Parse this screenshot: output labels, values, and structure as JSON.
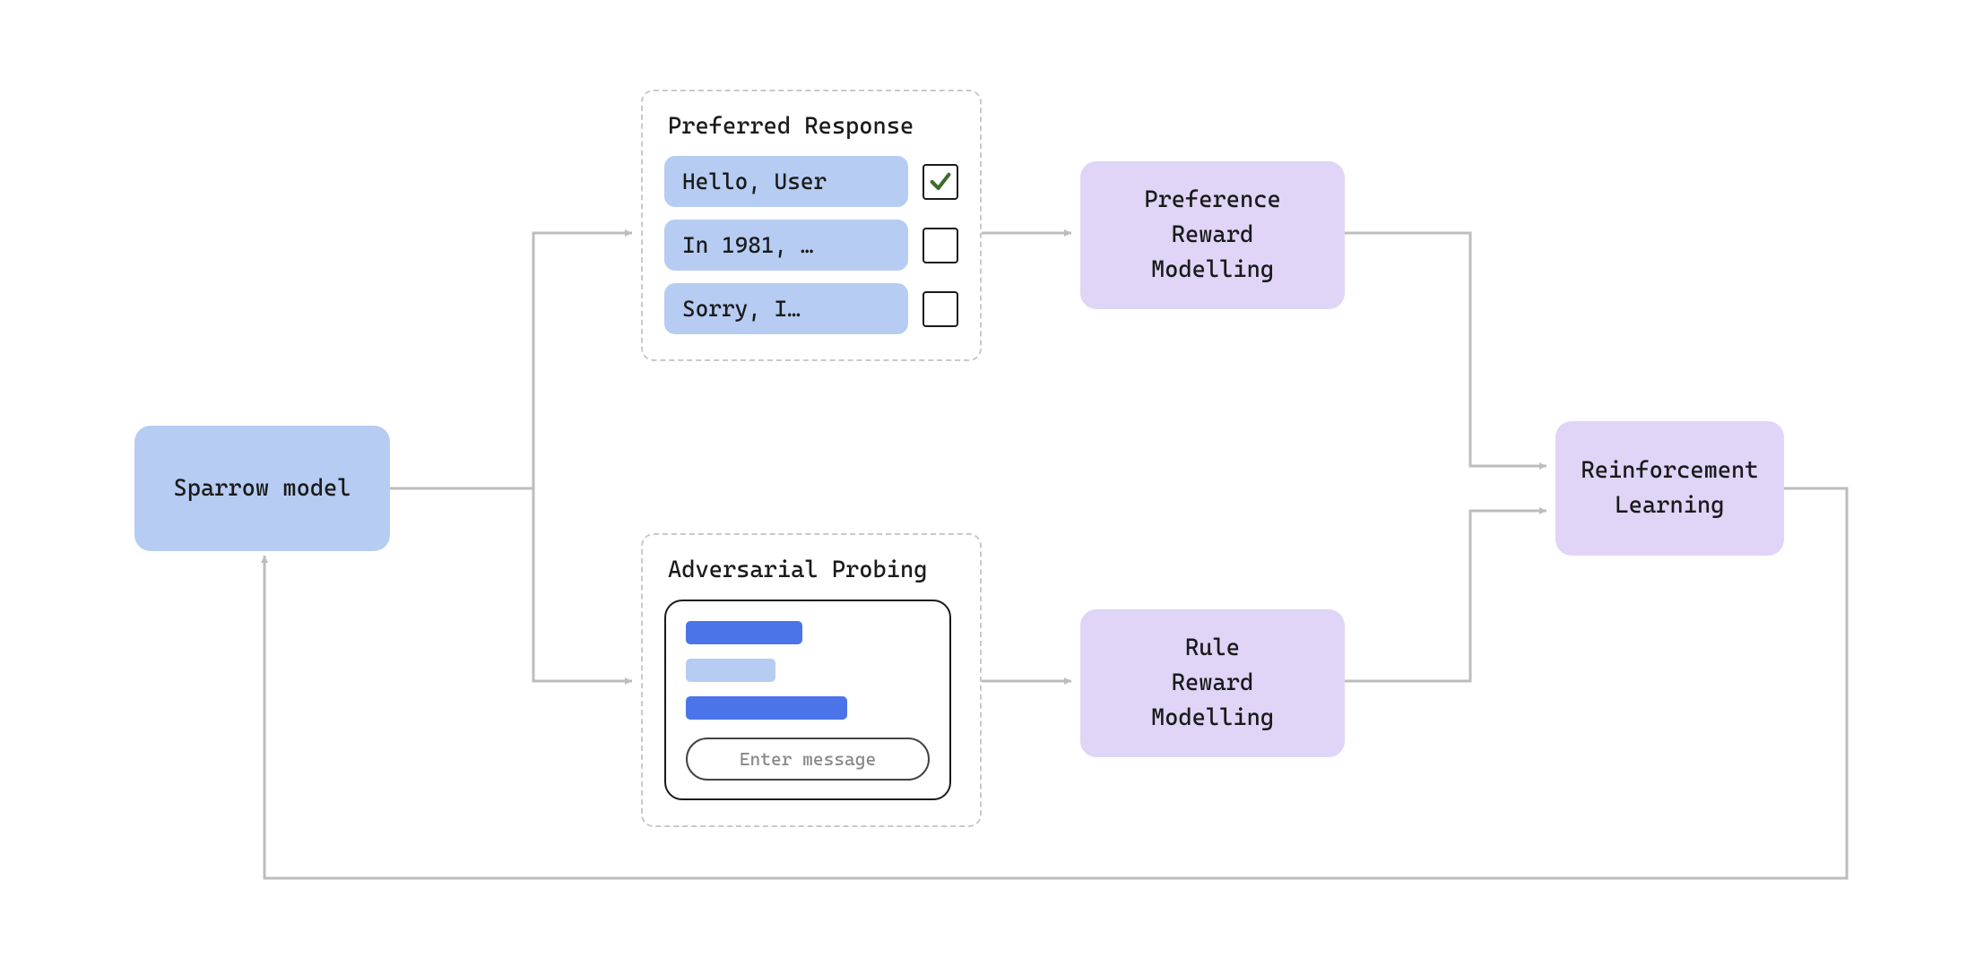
{
  "nodes": {
    "sparrow": "Sparrow model",
    "pref_reward": "Preference\nReward\nModelling",
    "rule_reward": "Rule\nReward\nModelling",
    "rl": "Reinforcement\nLearning"
  },
  "panels": {
    "preferred": {
      "title": "Preferred Response",
      "items": [
        {
          "label": "Hello, User",
          "checked": true
        },
        {
          "label": "In 1981, …",
          "checked": false
        },
        {
          "label": "Sorry, I…",
          "checked": false
        }
      ]
    },
    "adversarial": {
      "title": "Adversarial Probing",
      "chat_placeholder": "Enter message"
    }
  },
  "colors": {
    "blue": "#b6ccf2",
    "purple": "#e0d4f7",
    "arrow": "#bdbdbd",
    "check": "#3d6b2f"
  }
}
